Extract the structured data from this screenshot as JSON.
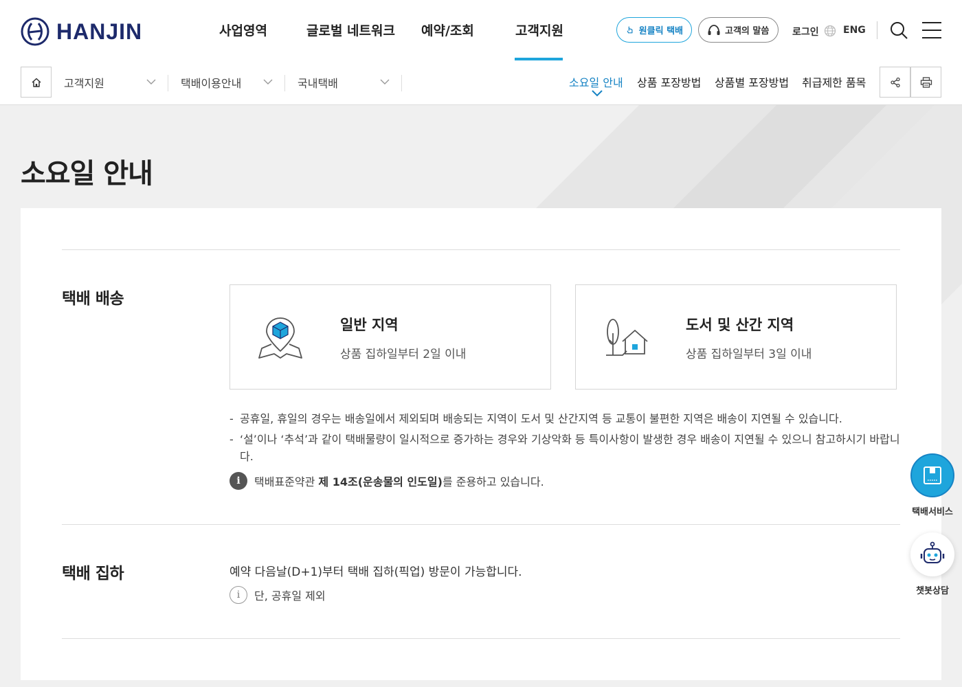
{
  "brand": {
    "name": "HANJIN",
    "color": "#1d2a6b",
    "accent": "#1ea5dc"
  },
  "gnb": [
    {
      "label": "사업영역"
    },
    {
      "label": "글로벌 네트워크"
    },
    {
      "label": "예약/조회"
    },
    {
      "label": "고객지원",
      "active": true
    }
  ],
  "utility": {
    "oneclick": "원클릭 택배",
    "voice": "고객의 말씀",
    "login": "로그인",
    "lang": "ENG"
  },
  "breadcrumb": [
    {
      "label": "고객지원"
    },
    {
      "label": "택배이용안내"
    },
    {
      "label": "국내택배"
    }
  ],
  "subtabs": [
    {
      "label": "소요일 안내",
      "active": true
    },
    {
      "label": "상품 포장방법"
    },
    {
      "label": "상품별 포장방법"
    },
    {
      "label": "취급제한 품목"
    }
  ],
  "page": {
    "title": "소요일 안내"
  },
  "delivery": {
    "title": "택배 배송",
    "regions": [
      {
        "title": "일반 지역",
        "desc": "상품 집하일부터 2일 이내",
        "icon": "map-pin-box-icon"
      },
      {
        "title": "도서 및 산간 지역",
        "desc": "상품 집하일부터 3일 이내",
        "icon": "house-tree-icon"
      }
    ],
    "notes": [
      "공휴일, 휴일의 경우는 배송일에서 제외되며 배송되는 지역이 도서 및 산간지역 등 교통이 불편한 지역은 배송이 지연될 수 있습니다.",
      "‘설’이나 ‘추석’과 같이 택배물량이 일시적으로 증가하는 경우와 기상악화 등 특이사항이 발생한 경우 배송이 지연될 수 있으니 참고하시기 바랍니다."
    ],
    "info_prefix": "택배표준약관",
    "info_bold": "제 14조(운송물의 인도일)",
    "info_suffix": "를 준용하고 있습니다."
  },
  "pickup": {
    "title": "택배 집하",
    "text": "예약 다음날(D+1)부터 택배 집하(픽업) 방문이 가능합니다.",
    "note": "단, 공휴일 제외"
  },
  "floating": {
    "service": "택배서비스",
    "chatbot": "챗봇상담"
  }
}
